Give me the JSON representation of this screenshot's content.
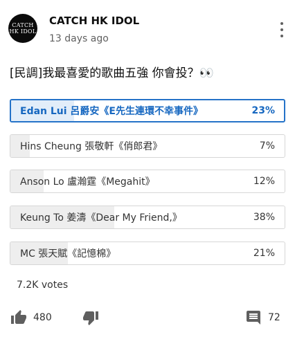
{
  "post": {
    "channel": {
      "avatar_line1": "CATCH",
      "avatar_line2": "HK IDOL",
      "name": "CATCH HK IDOL",
      "time": "13 days ago"
    },
    "text": "[民調]我最喜愛的歌曲五強 你會投？👀"
  },
  "poll": {
    "options": [
      {
        "label": "Edan Lui 呂爵安《E先生連環不幸事件》",
        "percent_label": "23%",
        "percent": 23,
        "selected": true
      },
      {
        "label": "Hins Cheung 張敬軒《俏郎君》",
        "percent_label": "7%",
        "percent": 7,
        "selected": false
      },
      {
        "label": "Anson Lo 盧瀚霆《Megahit》",
        "percent_label": "12%",
        "percent": 12,
        "selected": false
      },
      {
        "label": "Keung To 姜濤《Dear My Friend,》",
        "percent_label": "38%",
        "percent": 38,
        "selected": false
      },
      {
        "label": "MC 張天賦《記憶棉》",
        "percent_label": "21%",
        "percent": 21,
        "selected": false
      }
    ],
    "votes": "7.2K votes"
  },
  "actions": {
    "likes": "480",
    "comments": "72",
    "like_icon": "thumbs-up-icon",
    "dislike_icon": "thumbs-down-icon",
    "comment_icon": "comment-icon"
  },
  "colors": {
    "selected_accent": "#2472c8",
    "selected_fill": "#e2edf9",
    "unselected_fill": "#eeeeee"
  }
}
